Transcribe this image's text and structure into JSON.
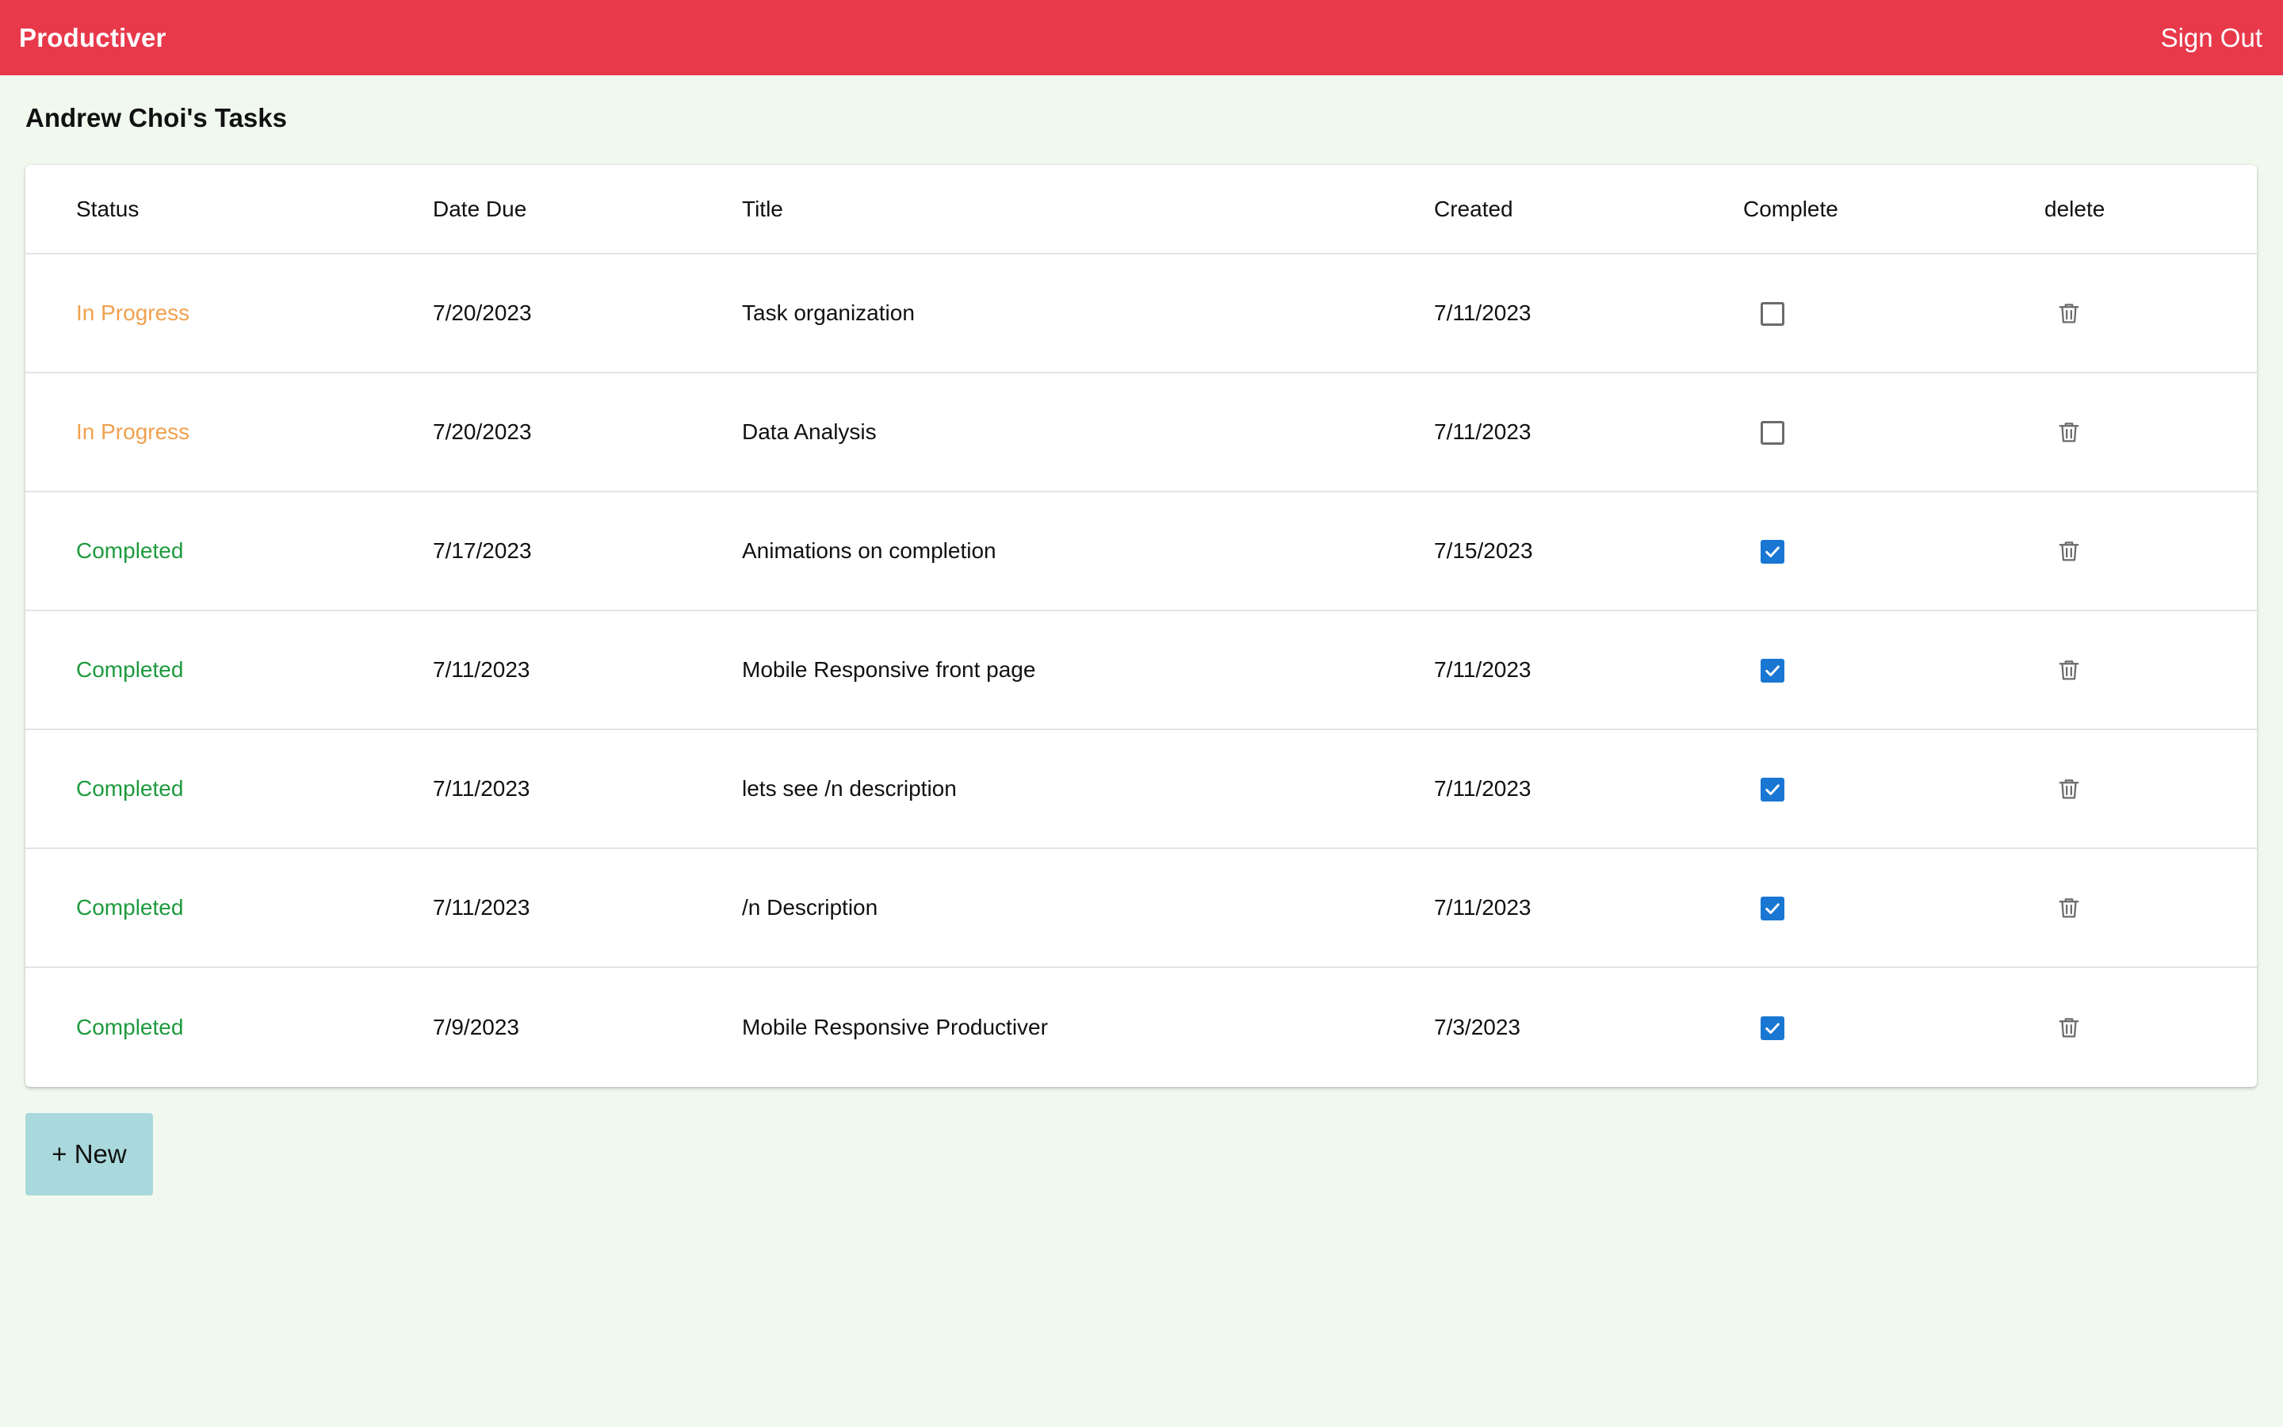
{
  "app": {
    "brand": "Productiver",
    "sign_out_label": "Sign Out"
  },
  "page": {
    "title": "Andrew Choi's Tasks"
  },
  "table": {
    "columns": {
      "status": "Status",
      "date_due": "Date Due",
      "title": "Title",
      "created": "Created",
      "complete": "Complete",
      "delete": "delete"
    },
    "rows": [
      {
        "status": "In Progress",
        "date_due": "7/20/2023",
        "title": "Task organization",
        "created": "7/11/2023",
        "complete": false
      },
      {
        "status": "In Progress",
        "date_due": "7/20/2023",
        "title": "Data Analysis",
        "created": "7/11/2023",
        "complete": false
      },
      {
        "status": "Completed",
        "date_due": "7/17/2023",
        "title": "Animations on completion",
        "created": "7/15/2023",
        "complete": true
      },
      {
        "status": "Completed",
        "date_due": "7/11/2023",
        "title": "Mobile Responsive front page",
        "created": "7/11/2023",
        "complete": true
      },
      {
        "status": "Completed",
        "date_due": "7/11/2023",
        "title": "lets see /n description",
        "created": "7/11/2023",
        "complete": true
      },
      {
        "status": "Completed",
        "date_due": "7/11/2023",
        "title": "/n Description",
        "created": "7/11/2023",
        "complete": true
      },
      {
        "status": "Completed",
        "date_due": "7/9/2023",
        "title": "Mobile Responsive Productiver",
        "created": "7/3/2023",
        "complete": true
      }
    ]
  },
  "actions": {
    "new_label": "+ New"
  },
  "colors": {
    "topbar": "#e8394b",
    "background": "#f1f9ee",
    "status_in_progress": "#f0a14e",
    "status_completed": "#1e9a3e",
    "checkbox_checked": "#1976d2",
    "new_button": "#a9d9dc"
  },
  "icons": {
    "delete": "trash-icon",
    "complete_checked": "checkbox-checked-icon",
    "complete_unchecked": "checkbox-unchecked-icon"
  }
}
